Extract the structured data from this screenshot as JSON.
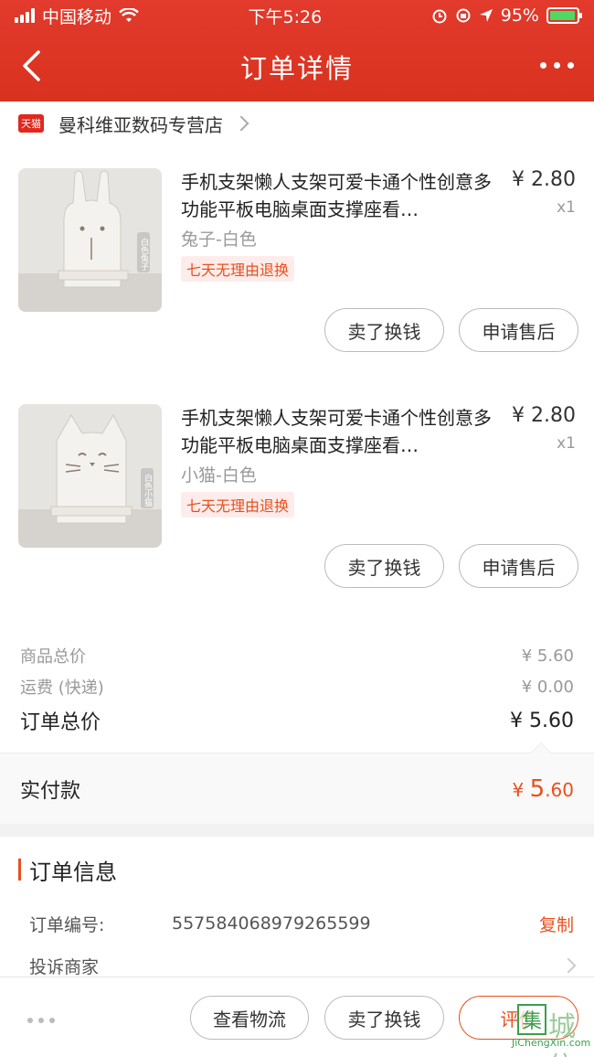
{
  "status_bar": {
    "carrier": "中国移动",
    "time": "下午5:26",
    "battery": "95%"
  },
  "navbar": {
    "title": "订单详情"
  },
  "shop": {
    "badge": "天猫",
    "name": "曼科维亚数码专营店"
  },
  "items": [
    {
      "title": "手机支架懒人支架可爱卡通个性创意多功能平板电脑桌面支撑座看…",
      "price": "¥ 2.80",
      "qty": "x1",
      "sku": "兔子-白色",
      "tag": "七天无理由退换",
      "sell_label": "卖了换钱",
      "after_sale_label": "申请售后",
      "thumb_caption": "白色兔子"
    },
    {
      "title": "手机支架懒人支架可爱卡通个性创意多功能平板电脑桌面支撑座看…",
      "price": "¥ 2.80",
      "qty": "x1",
      "sku": "小猫-白色",
      "tag": "七天无理由退换",
      "sell_label": "卖了换钱",
      "after_sale_label": "申请售后",
      "thumb_caption": "白色小猫"
    }
  ],
  "summary": {
    "goods_total_label": "商品总价",
    "goods_total": "¥ 5.60",
    "shipping_label": "运费 (快递)",
    "shipping": "¥ 0.00",
    "order_total_label": "订单总价",
    "order_total": "¥ 5.60",
    "paid_label": "实付款",
    "paid_currency": "¥ ",
    "paid_int": "5",
    "paid_dec": ".60"
  },
  "order_info": {
    "title": "订单信息",
    "order_no_label": "订单编号:",
    "order_no": "557584068979265599",
    "copy_label": "复制",
    "complain_label": "投诉商家"
  },
  "bottom_bar": {
    "logistics_label": "查看物流",
    "sell_label": "卖了换钱",
    "review_label": "评价"
  },
  "watermark": {
    "char": "集",
    "text": "城信",
    "url": "JiChengXin.com"
  },
  "colors": {
    "header": "#d9321f",
    "accent": "#e8501d"
  }
}
